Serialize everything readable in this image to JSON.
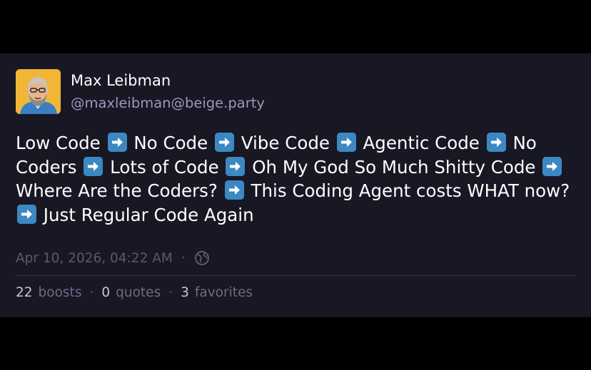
{
  "author": {
    "name": "Max Leibman",
    "handle": "@maxleibman@beige.party"
  },
  "post": {
    "lines": [
      [
        "Low Code",
        "No Code",
        "Vibe Code",
        "Agentic Code",
        "No"
      ],
      [
        "Coders",
        "Lots of Code",
        "Oh My God So Much Shitty Code",
        ""
      ],
      [
        "Where Are the Coders?",
        "This Coding Agent costs WHAT now?"
      ],
      [
        "",
        "Just Regular Code Again"
      ]
    ],
    "separator_icon": "right-arrow-emoji-icon"
  },
  "meta": {
    "timestamp": "Apr 10, 2026, 04:22 AM",
    "dot": "·",
    "visibility_icon": "globe-icon"
  },
  "stats": {
    "boosts_count": "22",
    "boosts_label": "boosts",
    "quotes_count": "0",
    "quotes_label": "quotes",
    "favorites_count": "3",
    "favorites_label": "favorites",
    "separator": "·"
  },
  "colors": {
    "background": "#000000",
    "card": "#181724",
    "text": "#ffffff",
    "handle": "#9c98b8",
    "muted": "#5b5870",
    "arrow_emoji": "#3b88c3",
    "avatar_bg": "#f2b637"
  }
}
